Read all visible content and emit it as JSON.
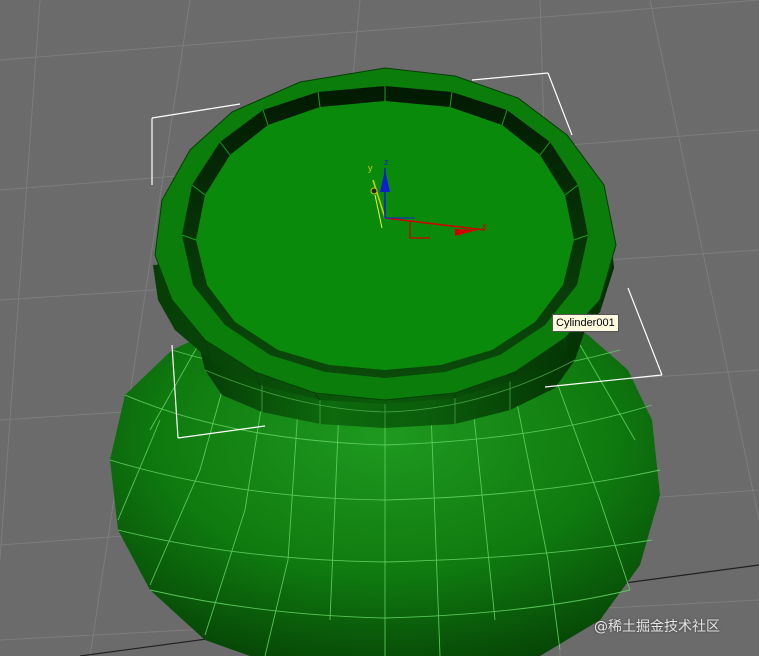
{
  "viewport": {
    "object_name": "Cylinder001",
    "object_color": "#0a7d0a",
    "selection_bracket_color": "#ffffff",
    "wire_color": "#6bd56b"
  },
  "gizmo": {
    "x_label": "x",
    "y_label": "y",
    "z_label": "z",
    "x_color": "#d00000",
    "y_color": "#c8d000",
    "z_color": "#1020d0"
  },
  "watermark": {
    "text": "@稀土掘金技术社区"
  }
}
